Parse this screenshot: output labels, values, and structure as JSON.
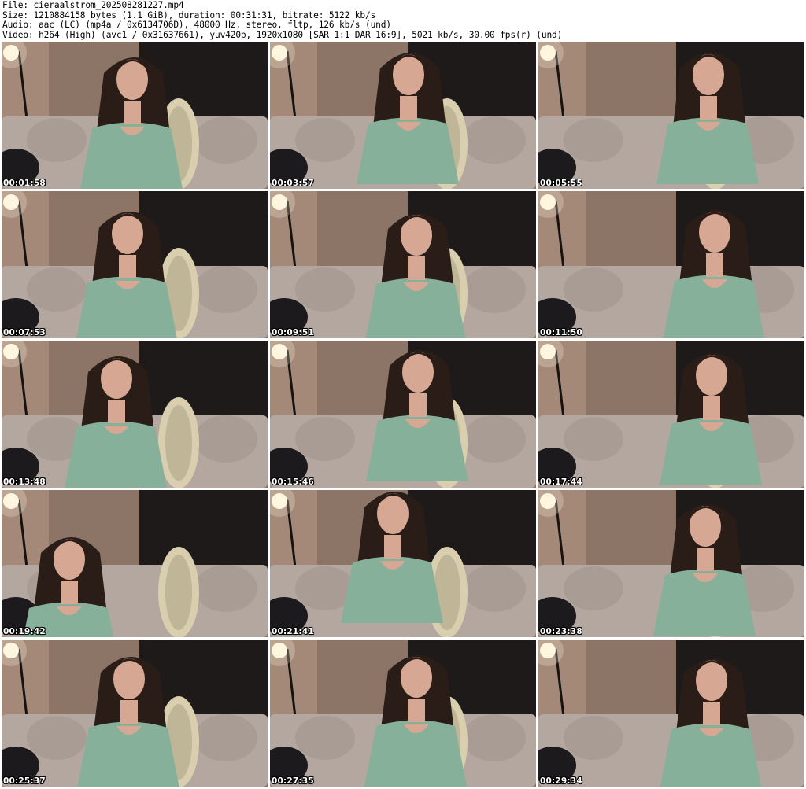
{
  "header": {
    "file_line": "File: cieraalstrom_202508281227.mp4",
    "size_line": "Size: 1210884158 bytes (1.1 GiB), duration: 00:31:31, bitrate: 5122 kb/s",
    "audio_line": "Audio: aac (LC) (mp4a / 0x6134706D), 48000 Hz, stereo, fltp, 126 kb/s (und)",
    "video_line": "Video: h264 (High) (avc1 / 0x31637661), yuv420p, 1920x1080 [SAR 1:1 DAR 16:9], 5021 kb/s, 30.00 fps(r) (und)"
  },
  "colors": {
    "wall": "#8c7466",
    "curtain": "#1e1a19",
    "sofa": "#b3a79f",
    "pillow": "#a89c94",
    "top": "#86b09a",
    "hair": "#2a1c17",
    "skin": "#d6a893",
    "chair": "#d9cfae",
    "lamp": "#fff6e0"
  },
  "thumbnails": [
    {
      "timestamp": "00:01:58"
    },
    {
      "timestamp": "00:03:57"
    },
    {
      "timestamp": "00:05:55"
    },
    {
      "timestamp": "00:07:53"
    },
    {
      "timestamp": "00:09:51"
    },
    {
      "timestamp": "00:11:50"
    },
    {
      "timestamp": "00:13:48"
    },
    {
      "timestamp": "00:15:46"
    },
    {
      "timestamp": "00:17:44"
    },
    {
      "timestamp": "00:19:42"
    },
    {
      "timestamp": "00:21:41"
    },
    {
      "timestamp": "00:23:38"
    },
    {
      "timestamp": "00:25:37"
    },
    {
      "timestamp": "00:27:35"
    },
    {
      "timestamp": "00:29:34"
    }
  ]
}
